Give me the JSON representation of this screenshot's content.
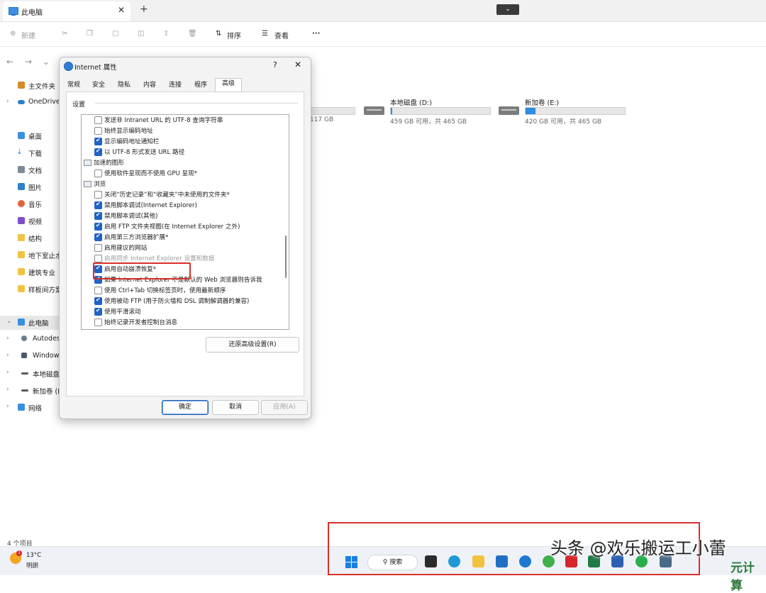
{
  "explorer": {
    "tab_title": "此电脑",
    "close_glyph": "✕",
    "add_glyph": "+",
    "chevron_glyph": "⌄",
    "toolbar": {
      "new_label": "新建",
      "sort_label": "排序",
      "view_label": "查看",
      "more_label": "···"
    },
    "nav": {
      "back": "←",
      "forward": "→",
      "down": "⌄"
    },
    "sidebar": [
      {
        "label": "主文件夹",
        "icon": "home-icon",
        "caret": ""
      },
      {
        "label": "OneDrive",
        "icon": "cloud-icon",
        "caret": "›"
      },
      {
        "label": "桌面",
        "icon": "desktop-icon",
        "caret": ""
      },
      {
        "label": "下载",
        "icon": "download-icon",
        "caret": ""
      },
      {
        "label": "文档",
        "icon": "document-icon",
        "caret": ""
      },
      {
        "label": "图片",
        "icon": "picture-icon",
        "caret": ""
      },
      {
        "label": "音乐",
        "icon": "music-icon",
        "caret": ""
      },
      {
        "label": "视频",
        "icon": "video-icon",
        "caret": ""
      },
      {
        "label": "结构",
        "icon": "folder-icon",
        "caret": ""
      },
      {
        "label": "地下室止水",
        "icon": "folder-icon",
        "caret": ""
      },
      {
        "label": "建筑专业",
        "icon": "folder-icon",
        "caret": ""
      },
      {
        "label": "样板间方案",
        "icon": "folder-icon",
        "caret": ""
      },
      {
        "label": "此电脑",
        "icon": "computer-icon",
        "caret": "⌄"
      },
      {
        "label": "Autodesk",
        "icon": "app-icon",
        "caret": "›"
      },
      {
        "label": "Windows",
        "icon": "windows-icon",
        "caret": "›"
      },
      {
        "label": "本地磁盘",
        "icon": "drive-icon",
        "caret": "›"
      },
      {
        "label": "新加卷 (E",
        "icon": "drive-icon",
        "caret": "›"
      },
      {
        "label": "网络",
        "icon": "network-icon",
        "caret": "›"
      }
    ],
    "drive_c": {
      "space": "117 GB"
    },
    "drives": [
      {
        "name": "本地磁盘 (D:)",
        "space": "459 GB 可用，共 465 GB",
        "used_fraction": 0.013
      },
      {
        "name": "新加卷 (E:)",
        "space": "420 GB 可用，共 465 GB",
        "used_fraction": 0.097
      }
    ],
    "status_count": "4 个项目"
  },
  "dialog": {
    "title": "Internet 属性",
    "help": "?",
    "close": "✕",
    "tabs": [
      "常规",
      "安全",
      "隐私",
      "内容",
      "连接",
      "程序",
      "高级"
    ],
    "active_tab": "高级",
    "settings_label": "设置",
    "settings": [
      {
        "type": "check",
        "checked": false,
        "label": "发送非 Intranet URL 的 UTF-8 查询字符串"
      },
      {
        "type": "check",
        "checked": false,
        "label": "始终显示编码地址"
      },
      {
        "type": "check",
        "checked": true,
        "label": "显示编码地址通知栏"
      },
      {
        "type": "check",
        "checked": true,
        "label": "以 UTF-8 形式发送 URL 路径"
      },
      {
        "type": "category",
        "label": "加速的图形"
      },
      {
        "type": "check",
        "checked": false,
        "label": "使用软件呈现而不使用 GPU 呈现*"
      },
      {
        "type": "category",
        "label": "浏览"
      },
      {
        "type": "check",
        "checked": false,
        "label": "关闭“历史记录”和“收藏夹”中未使用的文件夹*"
      },
      {
        "type": "check",
        "checked": true,
        "label": "禁用脚本调试(Internet Explorer)"
      },
      {
        "type": "check",
        "checked": true,
        "label": "禁用脚本调试(其他)"
      },
      {
        "type": "check",
        "checked": true,
        "label": "启用 FTP 文件夹视图(在 Internet Explorer 之外)"
      },
      {
        "type": "check",
        "checked": true,
        "label": "启用第三方浏览器扩展*"
      },
      {
        "type": "check",
        "checked": false,
        "label": "启用建议的网站"
      },
      {
        "type": "check",
        "checked": false,
        "gray": true,
        "label": "启用同步 Internet Explorer 设置和数据"
      },
      {
        "type": "check",
        "checked": true,
        "label": "启用自动崩溃恢复*"
      },
      {
        "type": "check",
        "checked": true,
        "label": "如果 Internet Explorer 不是默认的 Web 浏览器则告诉我"
      },
      {
        "type": "check",
        "checked": false,
        "label": "使用 Ctrl+Tab 切换标签页时，使用最新顺序"
      },
      {
        "type": "check",
        "checked": true,
        "label": "使用被动 FTP (用于防火墙和 DSL 调制解调器的兼容)"
      },
      {
        "type": "check",
        "checked": true,
        "label": "使用平滑滚动"
      },
      {
        "type": "check",
        "checked": false,
        "label": "始终记录开发者控制台消息"
      }
    ],
    "restore_button": "还原高级设置(R)",
    "ok_button": "确定",
    "cancel_button": "取消",
    "apply_button": "应用(A)"
  },
  "taskbar": {
    "temperature": "13°C",
    "weather": "明朗",
    "weather_badge": "1",
    "search_label": "搜索",
    "apps": [
      "task-view-icon",
      "edge-icon",
      "file-explorer-icon",
      "mail-icon",
      "ie-icon",
      "360-browser-icon",
      "acrobat-icon",
      "excel-icon",
      "word-icon",
      "wechat-icon",
      "app-icon"
    ]
  },
  "overlay": {
    "watermark": "头条 @欢乐搬运工小蕾",
    "corner_mark": "元计算"
  },
  "colors": {
    "accent": "#1f63c7",
    "highlight_red": "#d9302a",
    "drive_fill": "#2f8ee3"
  }
}
